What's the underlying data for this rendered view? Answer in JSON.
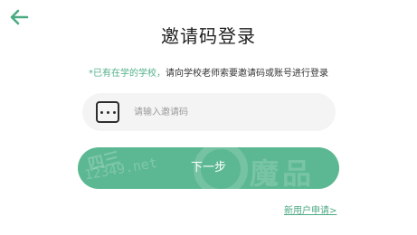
{
  "header": {
    "back_icon": "arrow-left-icon",
    "title": "邀请码登录"
  },
  "hint": {
    "prefix": "*已有在学的学校，",
    "text": "请向学校老师索要邀请码或账号进行登录"
  },
  "invite": {
    "icon": "dots-box-icon",
    "placeholder": "请输入邀请码",
    "value": ""
  },
  "next_button": {
    "label": "下一步"
  },
  "watermark": {
    "text1": "四三",
    "text2": "12349.net",
    "text3": "魔品"
  },
  "footer": {
    "apply_link": "新用户申请>"
  },
  "colors": {
    "accent": "#5cb892",
    "link": "#4caa82"
  }
}
